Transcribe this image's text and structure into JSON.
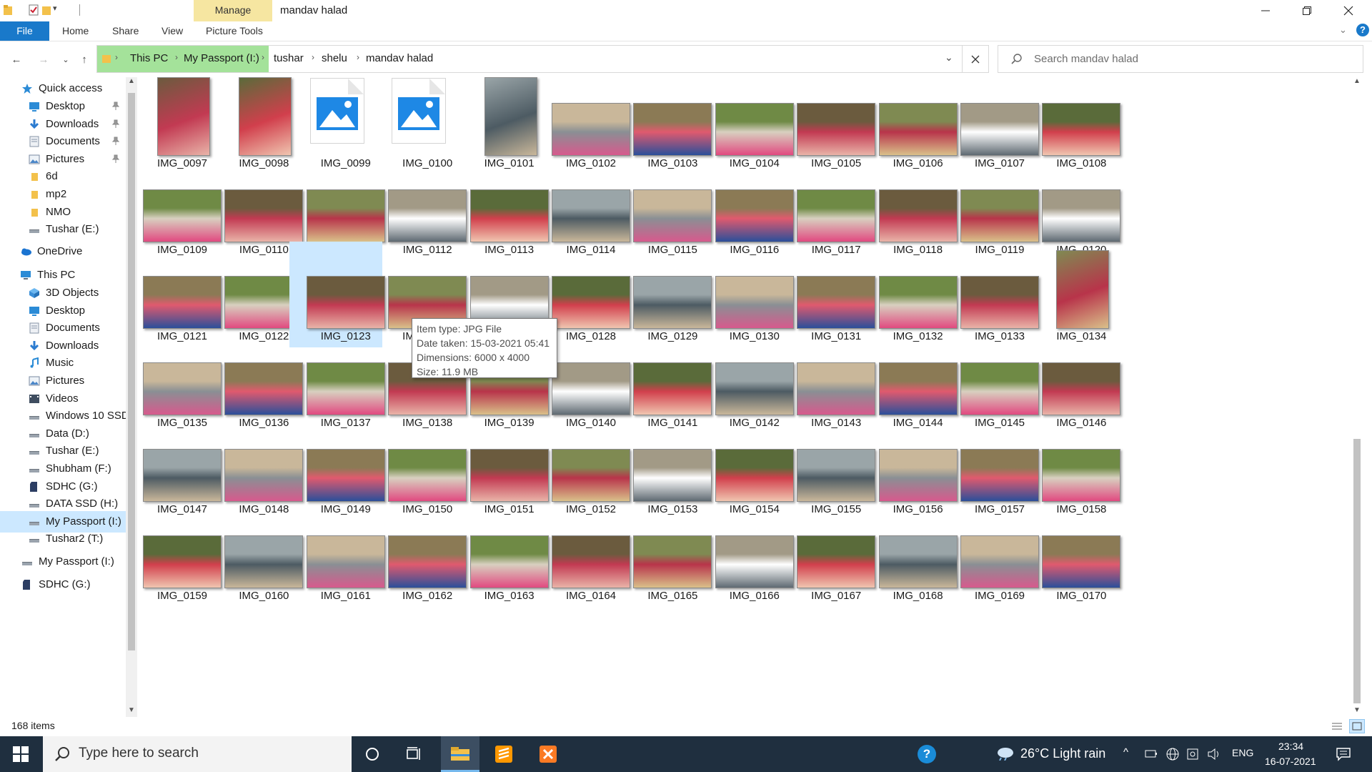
{
  "window": {
    "title": "mandav halad",
    "context_tab_group": "Manage"
  },
  "ribbon": {
    "tabs": [
      "File",
      "Home",
      "Share",
      "View",
      "Picture Tools"
    ]
  },
  "address": {
    "crumbs": [
      "This PC",
      "My Passport (I:)",
      "tushar",
      "shelu",
      "mandav halad"
    ]
  },
  "search": {
    "placeholder": "Search mandav halad"
  },
  "nav": {
    "quick_access": "Quick access",
    "quick_items": [
      "Desktop",
      "Downloads",
      "Documents",
      "Pictures",
      "6d",
      "mp2",
      "NMO",
      "Tushar (E:)"
    ],
    "onedrive": "OneDrive",
    "this_pc": "This PC",
    "pc_items": [
      "3D Objects",
      "Desktop",
      "Documents",
      "Downloads",
      "Music",
      "Pictures",
      "Videos",
      "Windows 10 SSD",
      "Data (D:)",
      "Tushar (E:)",
      "Shubham (F:)",
      "SDHC (G:)",
      "DATA SSD (H:)",
      "My Passport (I:)",
      "Tushar2 (T:)"
    ],
    "bottom_items": [
      "My Passport (I:)",
      "SDHC (G:)"
    ]
  },
  "files": [
    "IMG_0097",
    "IMG_0098",
    "IMG_0099",
    "IMG_0100",
    "IMG_0101",
    "IMG_0102",
    "IMG_0103",
    "IMG_0104",
    "IMG_0105",
    "IMG_0106",
    "IMG_0107",
    "IMG_0108",
    "IMG_0109",
    "IMG_0110",
    "IMG_0111",
    "IMG_0112",
    "IMG_0113",
    "IMG_0114",
    "IMG_0115",
    "IMG_0116",
    "IMG_0117",
    "IMG_0118",
    "IMG_0119",
    "IMG_0120",
    "IMG_0121",
    "IMG_0122",
    "IMG_0123",
    "IMG_0124",
    "IMG_0125",
    "IMG_0128",
    "IMG_0129",
    "IMG_0130",
    "IMG_0131",
    "IMG_0132",
    "IMG_0133",
    "IMG_0134",
    "IMG_0135",
    "IMG_0136",
    "IMG_0137",
    "IMG_0138",
    "IMG_0139",
    "IMG_0140",
    "IMG_0141",
    "IMG_0142",
    "IMG_0143",
    "IMG_0144",
    "IMG_0145",
    "IMG_0146",
    "IMG_0147",
    "IMG_0148",
    "IMG_0149",
    "IMG_0150",
    "IMG_0151",
    "IMG_0152",
    "IMG_0153",
    "IMG_0154",
    "IMG_0155",
    "IMG_0156",
    "IMG_0157",
    "IMG_0158",
    "IMG_0159",
    "IMG_0160",
    "IMG_0161",
    "IMG_0162",
    "IMG_0163",
    "IMG_0164",
    "IMG_0165",
    "IMG_0166",
    "IMG_0167",
    "IMG_0168",
    "IMG_0169",
    "IMG_0170"
  ],
  "tooltip": {
    "item_type": "Item type: JPG File",
    "date_taken": "Date taken: 15-03-2021 05:41",
    "dimensions": "Dimensions: 6000 x 4000",
    "size": "Size: 11.9 MB"
  },
  "status": {
    "item_count": "168 items"
  },
  "taskbar": {
    "search_placeholder": "Type here to search",
    "weather": "26°C  Light rain",
    "language": "ENG",
    "time": "23:34",
    "date": "16-07-2021"
  },
  "colors": {
    "file_tab": "#1979ca",
    "manage_tab": "#f6e6a1",
    "address_highlight": "#a4e29a",
    "selection": "#cce8ff",
    "taskbar": "#1f2f3f"
  }
}
